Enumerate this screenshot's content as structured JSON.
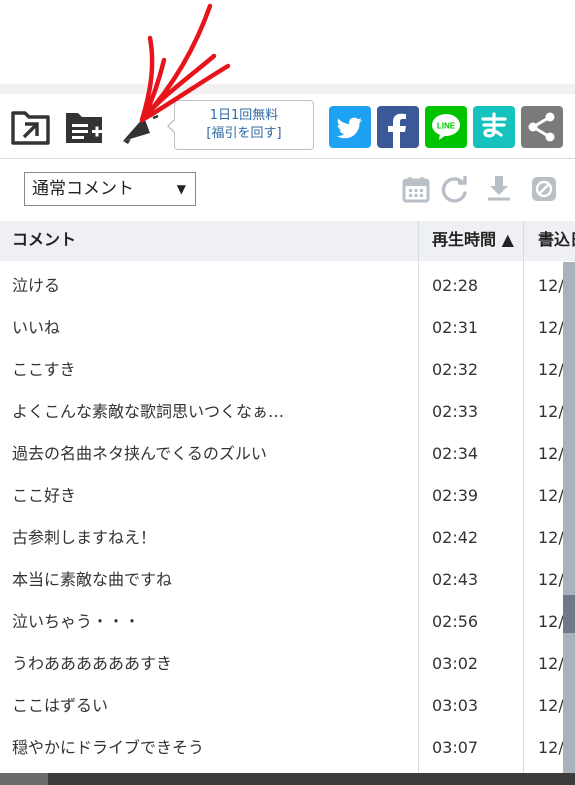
{
  "toolbar": {
    "tooltip_line1": "1日1回無料",
    "tooltip_line2": "[福引を回す]",
    "icons": [
      "open-folder-icon",
      "add-to-playlist-icon",
      "megaphone-icon"
    ],
    "share_buttons": [
      {
        "name": "twitter",
        "color": "#1da1f2"
      },
      {
        "name": "facebook",
        "color": "#3b5998"
      },
      {
        "name": "line",
        "color": "#00c300"
      },
      {
        "name": "matome",
        "color": "#16c2bd"
      },
      {
        "name": "share",
        "color": "#7a7a7a"
      }
    ]
  },
  "controls": {
    "comment_type_selected": "通常コメント",
    "icons": [
      "calendar-icon",
      "refresh-icon",
      "download-icon",
      "block-icon"
    ]
  },
  "table": {
    "headers": {
      "comment": "コメント",
      "time": "再生時間 ▲",
      "posted": "書込日"
    },
    "rows": [
      {
        "comment": "泣ける",
        "time": "02:28",
        "posted": "12/"
      },
      {
        "comment": "いいね",
        "time": "02:31",
        "posted": "12/"
      },
      {
        "comment": "ここすき",
        "time": "02:32",
        "posted": "12/"
      },
      {
        "comment": "よくこんな素敵な歌詞思いつくなぁ…",
        "time": "02:33",
        "posted": "12/"
      },
      {
        "comment": "過去の名曲ネタ挟んでくるのズルい",
        "time": "02:34",
        "posted": "12/"
      },
      {
        "comment": "ここ好き",
        "time": "02:39",
        "posted": "12/"
      },
      {
        "comment": "古参刺しますねえ！",
        "time": "02:42",
        "posted": "12/"
      },
      {
        "comment": "本当に素敵な曲ですね",
        "time": "02:43",
        "posted": "12/"
      },
      {
        "comment": "泣いちゃう・・・",
        "time": "02:56",
        "posted": "12/"
      },
      {
        "comment": "うわああああああすき",
        "time": "03:02",
        "posted": "12/"
      },
      {
        "comment": "ここはずるい",
        "time": "03:03",
        "posted": "12/"
      },
      {
        "comment": "穏やかにドライブできそう",
        "time": "03:07",
        "posted": "12/"
      }
    ]
  },
  "colors": {
    "annotation": "#e8141b",
    "icon": "#333333",
    "tooltip_text": "#2f6aa6",
    "disabled_icon": "#b9bfc6"
  }
}
